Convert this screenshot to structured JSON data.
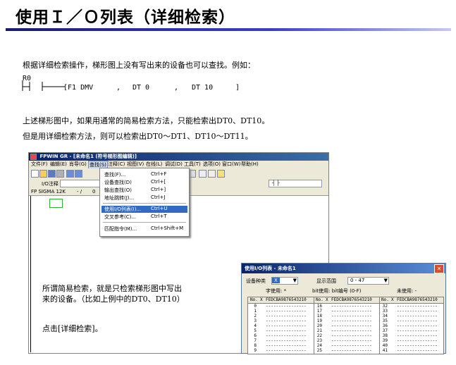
{
  "page": {
    "title": "使用Ｉ／Ｏ列表（详细检索）",
    "para1": "根据详细检索操作，梯形图上没有写出来的设备也可以查找。例如：",
    "ladder": {
      "contact": "R0",
      "instruction": "[F1 DMV",
      "arg1": "DT 0",
      "arg2": "DT 10",
      "comma": ",",
      "close": "]"
    },
    "para2": "上述梯形图中，如果用通常的简易检索方法，只能检索出DT0、DT10。",
    "para3": "但是用详细检索方法，则可以检索出DT0～DT1、DT10～DT11。",
    "note1": "所谓简易检索，就是只检索梯形图中写出",
    "note2": "来的设备。（比如上例中的DT0、DT10）",
    "note3": "点击[详细检索]。"
  },
  "app": {
    "title": "FPWIN GR - [未命名1 (符号梯形图编辑)]",
    "menus": [
      "文件(F)",
      "编辑(E)",
      "肖导(G)",
      "查找(S)",
      "注释(C)",
      "视图(V)",
      "在线(L)",
      "调试(D)",
      "工具(T)",
      "选项(O)",
      "窗口(W)",
      "帮助(H)"
    ],
    "io_comment_label": "I/O注释",
    "plc_label": "FP SIGMA 12K",
    "plc_sep": "- /",
    "plc_num": "0",
    "contact_symbol": "┤ ├",
    "dropdown": [
      {
        "label": "查找(F)...",
        "shortcut": "Ctrl+F"
      },
      {
        "label": "设备查找(D)",
        "shortcut": "Ctrl+["
      },
      {
        "label": "输出查找(O)",
        "shortcut": "Ctrl+]"
      },
      {
        "label": "地址跳转(J)...",
        "shortcut": "Ctrl+J"
      },
      {
        "label": "使用I/O列表(I)...",
        "shortcut": "Ctrl+U"
      },
      {
        "label": "交叉参考(C)...",
        "shortcut": "Ctrl+T"
      },
      {
        "label": "匹配指令(M)...",
        "shortcut": "Ctrl+Shift+M"
      }
    ]
  },
  "dialog": {
    "title": "使用I/O列表 - 未命名1",
    "device_type_label": "设备种类",
    "device_type_value": "X",
    "range_label": "显示范围",
    "range_value": "0 - 47",
    "legend_used": "字使用: *",
    "legend_bit": "bit使用: bit编号 (0-F)",
    "legend_unused": "未使用: -",
    "col_no": "No.",
    "col_x": "X",
    "col_bits": "FEDCBA9876543210",
    "col1": [
      "0",
      "1",
      "2",
      "3",
      "4",
      "5",
      "6",
      "7",
      "8",
      "9"
    ],
    "col2": [
      "16",
      "17",
      "18",
      "19",
      "20",
      "21",
      "22",
      "23",
      "24",
      "25"
    ],
    "col3": [
      "32",
      "33",
      "34",
      "35",
      "36",
      "37",
      "38",
      "39",
      "40",
      "41"
    ],
    "dash": "----------------"
  }
}
